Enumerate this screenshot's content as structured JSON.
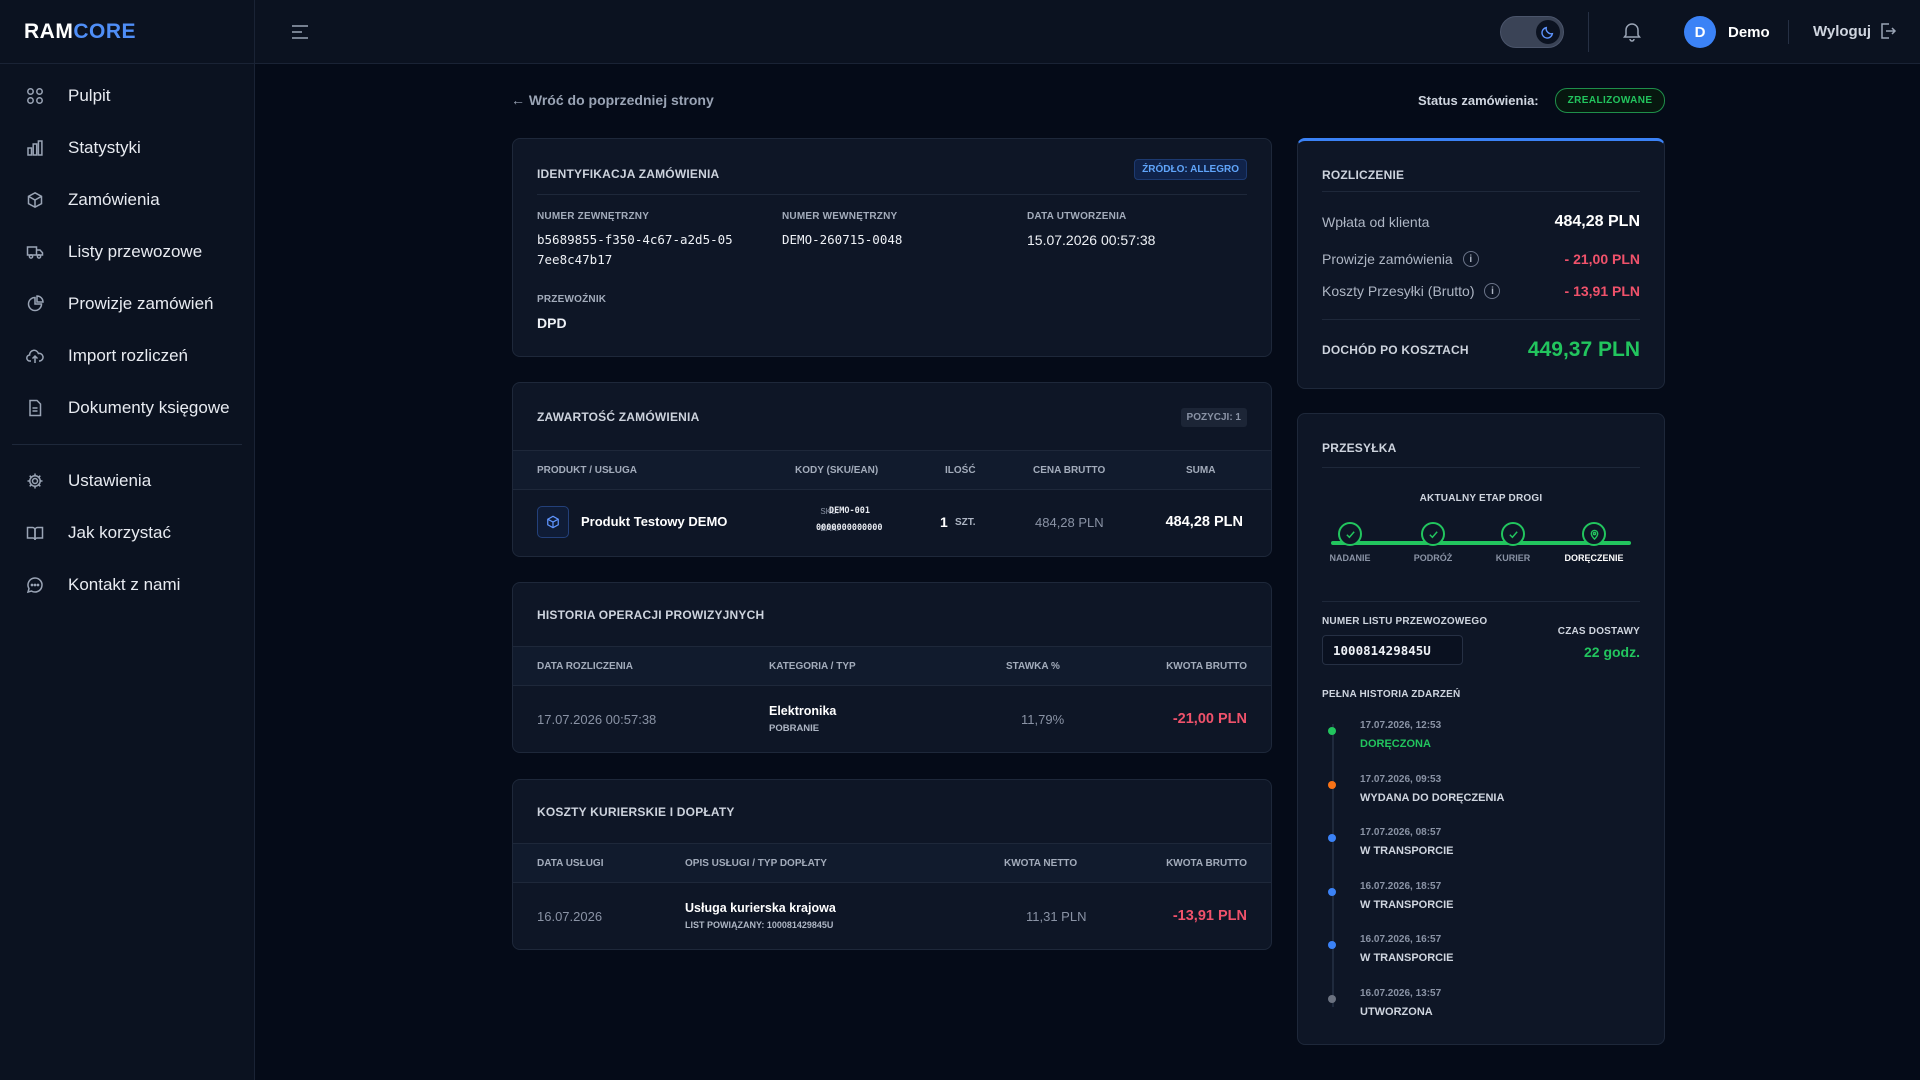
{
  "app": {
    "logo_part1": "RAM",
    "logo_part2": "CORE"
  },
  "sidebar": {
    "items": [
      {
        "label": "Pulpit",
        "icon": "dashboard-icon"
      },
      {
        "label": "Statystyki",
        "icon": "bar-chart-icon"
      },
      {
        "label": "Zamówienia",
        "icon": "box-icon"
      },
      {
        "label": "Listy przewozowe",
        "icon": "truck-icon"
      },
      {
        "label": "Prowizje zamówień",
        "icon": "pie-chart-icon"
      },
      {
        "label": "Import rozliczeń",
        "icon": "cloud-upload-icon"
      },
      {
        "label": "Dokumenty księgowe",
        "icon": "document-icon"
      }
    ],
    "bottom_items": [
      {
        "label": "Ustawienia",
        "icon": "gear-icon"
      },
      {
        "label": "Jak korzystać",
        "icon": "book-icon"
      },
      {
        "label": "Kontakt z nami",
        "icon": "chat-icon"
      }
    ]
  },
  "topbar": {
    "user_initial": "D",
    "user_name": "Demo",
    "logout_label": "Wyloguj"
  },
  "page": {
    "back_label": "← Wróć do poprzedniej strony",
    "status_label": "Status zamówienia:",
    "status_value": "ZREALIZOWANE"
  },
  "ident": {
    "title": "IDENTYFIKACJA ZAMÓWIENIA",
    "source_badge": "ŹRÓDŁO: ALLEGRO",
    "ext_label": "NUMER ZEWNĘTRZNY",
    "ext_value": "b5689855-f350-4c67-a2d5-057ee8c47b17",
    "int_label": "NUMER WEWNĘTRZNY",
    "int_value": "DEMO-260715-0048",
    "date_label": "DATA UTWORZENIA",
    "date_value": "15.07.2026 00:57:38",
    "carrier_label": "PRZEWOŹNIK",
    "carrier_value": "DPD"
  },
  "content": {
    "title": "ZAWARTOŚĆ ZAMÓWIENIA",
    "positions_badge": "POZYCJI: 1",
    "headers": [
      "PRODUKT / USŁUGA",
      "KODY (SKU/EAN)",
      "ILOŚĆ",
      "CENA BRUTTO",
      "SUMA"
    ],
    "row": {
      "product": "Produkt Testowy DEMO",
      "sku_label": "SKU:",
      "sku": "DEMO-001",
      "ean_label": "EAN:",
      "ean": "0000000000000",
      "qty": "1",
      "unit": "SZT.",
      "price": "484,28 PLN",
      "sum": "484,28 PLN"
    }
  },
  "history": {
    "title": "HISTORIA OPERACJI PROWIZYJNYCH",
    "headers": [
      "DATA ROZLICZENIA",
      "KATEGORIA / TYP",
      "STAWKA %",
      "KWOTA BRUTTO"
    ],
    "row": {
      "date": "17.07.2026 00:57:38",
      "category": "Elektronika",
      "type": "POBRANIE",
      "rate": "11,79%",
      "amount": "-21,00 PLN"
    }
  },
  "courier": {
    "title": "KOSZTY KURIERSKIE I DOPŁATY",
    "headers": [
      "DATA USŁUGI",
      "OPIS USŁUGI / TYP DOPŁATY",
      "KWOTA NETTO",
      "KWOTA BRUTTO"
    ],
    "row": {
      "date": "16.07.2026",
      "service": "Usługa kurierska krajowa",
      "linked": "LIST POWIĄZANY: 100081429845U",
      "net": "11,31 PLN",
      "gross": "-13,91 PLN"
    }
  },
  "settlement": {
    "title": "ROZLICZENIE",
    "payment_label": "Wpłata od klienta",
    "payment_value": "484,28 PLN",
    "commission_label": "Prowizje zamówienia",
    "commission_value": "- 21,00 PLN",
    "shipping_label": "Koszty Przesyłki (Brutto)",
    "shipping_value": "- 13,91 PLN",
    "income_label": "DOCHÓD PO KOSZTACH",
    "income_value": "449,37 PLN"
  },
  "shipment": {
    "title": "PRZESYŁKA",
    "stage_label": "AKTUALNY ETAP DROGI",
    "steps": [
      "NADANIE",
      "PODRÓŻ",
      "KURIER",
      "DORĘCZENIE"
    ],
    "waybill_label": "NUMER LISTU PRZEWOZOWEGO",
    "waybill_value": "100081429845U",
    "delivery_time_label": "CZAS DOSTAWY",
    "delivery_time_value": "22 godz.",
    "history_label": "PEŁNA HISTORIA ZDARZEŃ",
    "events": [
      {
        "time": "17.07.2026, 12:53",
        "name": "DORĘCZONA",
        "color": "#22c55e"
      },
      {
        "time": "17.07.2026, 09:53",
        "name": "WYDANA DO DORĘCZENIA",
        "color": "#f97316"
      },
      {
        "time": "17.07.2026, 08:57",
        "name": "W TRANSPORCIE",
        "color": "#3b82f6"
      },
      {
        "time": "16.07.2026, 18:57",
        "name": "W TRANSPORCIE",
        "color": "#3b82f6"
      },
      {
        "time": "16.07.2026, 16:57",
        "name": "W TRANSPORCIE",
        "color": "#3b82f6"
      },
      {
        "time": "16.07.2026, 13:57",
        "name": "UTWORZONA",
        "color": "#6b7280"
      }
    ]
  }
}
